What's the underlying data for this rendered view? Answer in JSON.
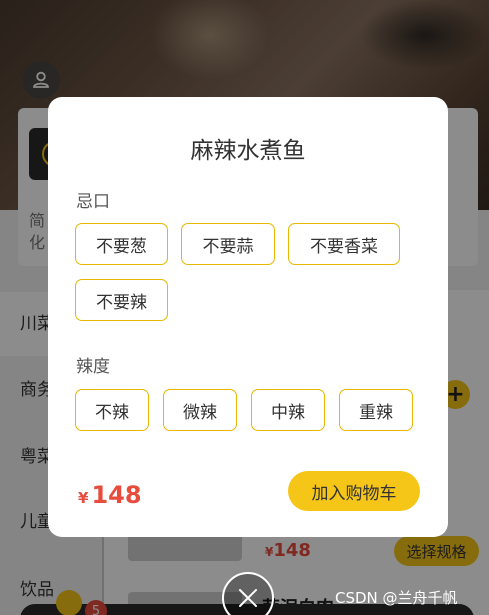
{
  "background": {
    "shop_desc_lines": [
      "简",
      "化"
    ],
    "side_menu": [
      "川菜",
      "商务",
      "粤菜",
      "儿童",
      "饮品"
    ],
    "item_price": "148",
    "item_currency": "¥",
    "spec_button_label": "选择规格",
    "plus_label": "+",
    "next_item_name": "蒜泥白肉",
    "cart_count": "5"
  },
  "modal": {
    "title": "麻辣水煮鱼",
    "sections": [
      {
        "label": "忌口",
        "options": [
          "不要葱",
          "不要蒜",
          "不要香菜",
          "不要辣"
        ]
      },
      {
        "label": "辣度",
        "options": [
          "不辣",
          "微辣",
          "中辣",
          "重辣"
        ]
      }
    ],
    "currency": "¥",
    "price": "148",
    "add_to_cart_label": "加入购物车"
  },
  "watermark": "CSDN @兰舟千帆",
  "colors": {
    "accent": "#f5c518",
    "price": "#e74c3c",
    "option_border": "#e6b800"
  },
  "icons": [
    "user-icon",
    "close-icon"
  ]
}
